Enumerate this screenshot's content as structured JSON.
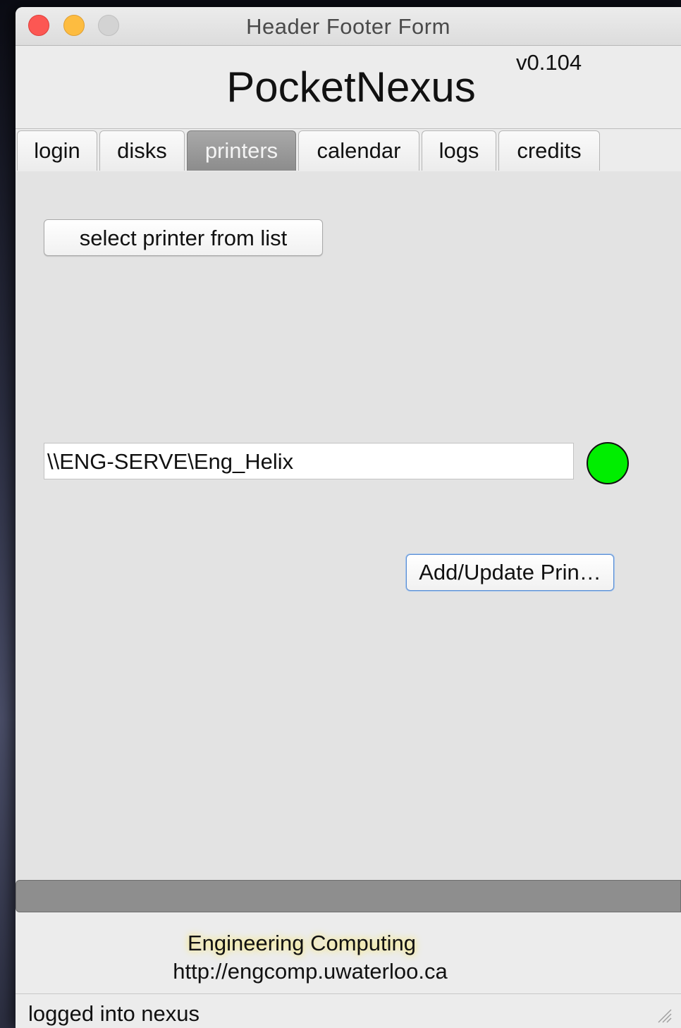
{
  "window": {
    "title": "Header Footer Form"
  },
  "header": {
    "app_title": "PocketNexus",
    "version": "v0.104"
  },
  "tabs": [
    {
      "label": "login",
      "active": false
    },
    {
      "label": "disks",
      "active": false
    },
    {
      "label": "printers",
      "active": true
    },
    {
      "label": "calendar",
      "active": false
    },
    {
      "label": "logs",
      "active": false
    },
    {
      "label": "credits",
      "active": false
    }
  ],
  "printers": {
    "select_button_label": "select printer from list",
    "printer_path": "\\\\ENG-SERVE\\Eng_Helix",
    "status_color": "#00ee00",
    "add_update_button_label": "Add/Update Prin…"
  },
  "progress": {
    "value": 0
  },
  "footer": {
    "organization": "Engineering Computing",
    "url": "http://engcomp.uwaterloo.ca"
  },
  "statusbar": {
    "text": "logged into nexus"
  },
  "icons": {
    "close": "close-icon",
    "minimize": "minimize-icon",
    "maximize": "maximize-icon",
    "resize": "resize-grip-icon"
  }
}
